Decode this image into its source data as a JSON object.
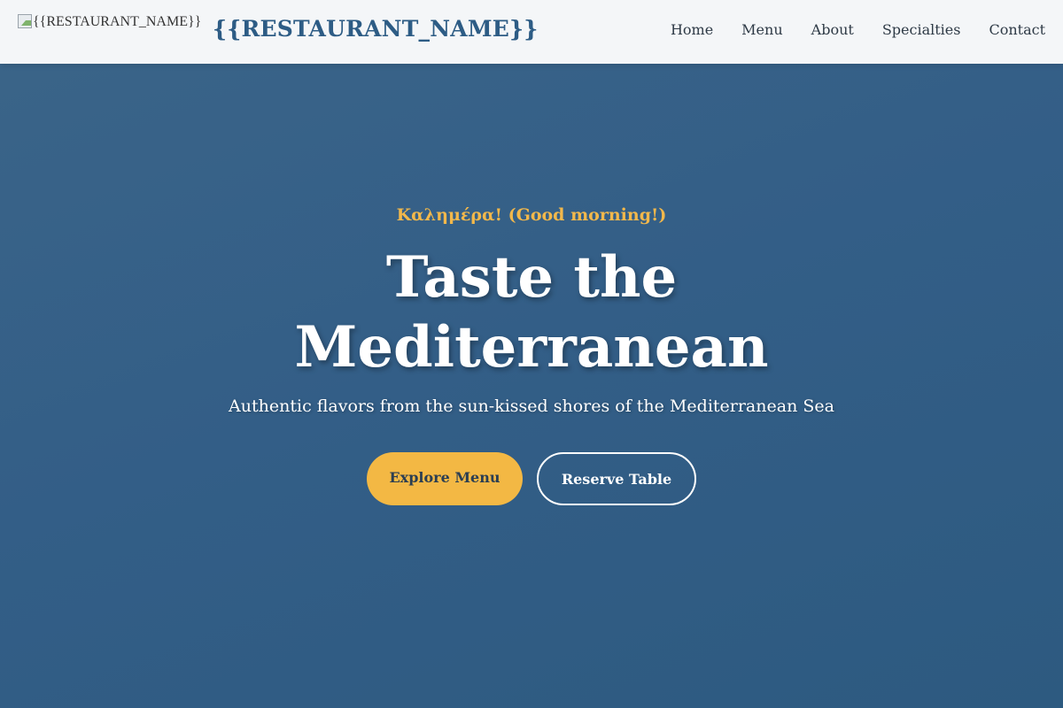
{
  "header": {
    "logo_alt": "{{RESTAURANT_NAME}}",
    "brand": "{{RESTAURANT_NAME}}",
    "nav": [
      {
        "label": "Home"
      },
      {
        "label": "Menu"
      },
      {
        "label": "About"
      },
      {
        "label": "Specialties"
      },
      {
        "label": "Contact"
      }
    ]
  },
  "hero": {
    "greeting": "Καλημέρα! (Good morning!)",
    "headline": "Taste the Mediterranean",
    "subtitle": "Authentic flavors from the sun-kissed shores of the Mediterranean Sea",
    "primary_cta": "Explore Menu",
    "secondary_cta": "Reserve Table"
  },
  "colors": {
    "header_bg": "#f4f6f8",
    "brand": "#2d5c85",
    "hero_bg": "#335f88",
    "accent": "#f3b844"
  }
}
